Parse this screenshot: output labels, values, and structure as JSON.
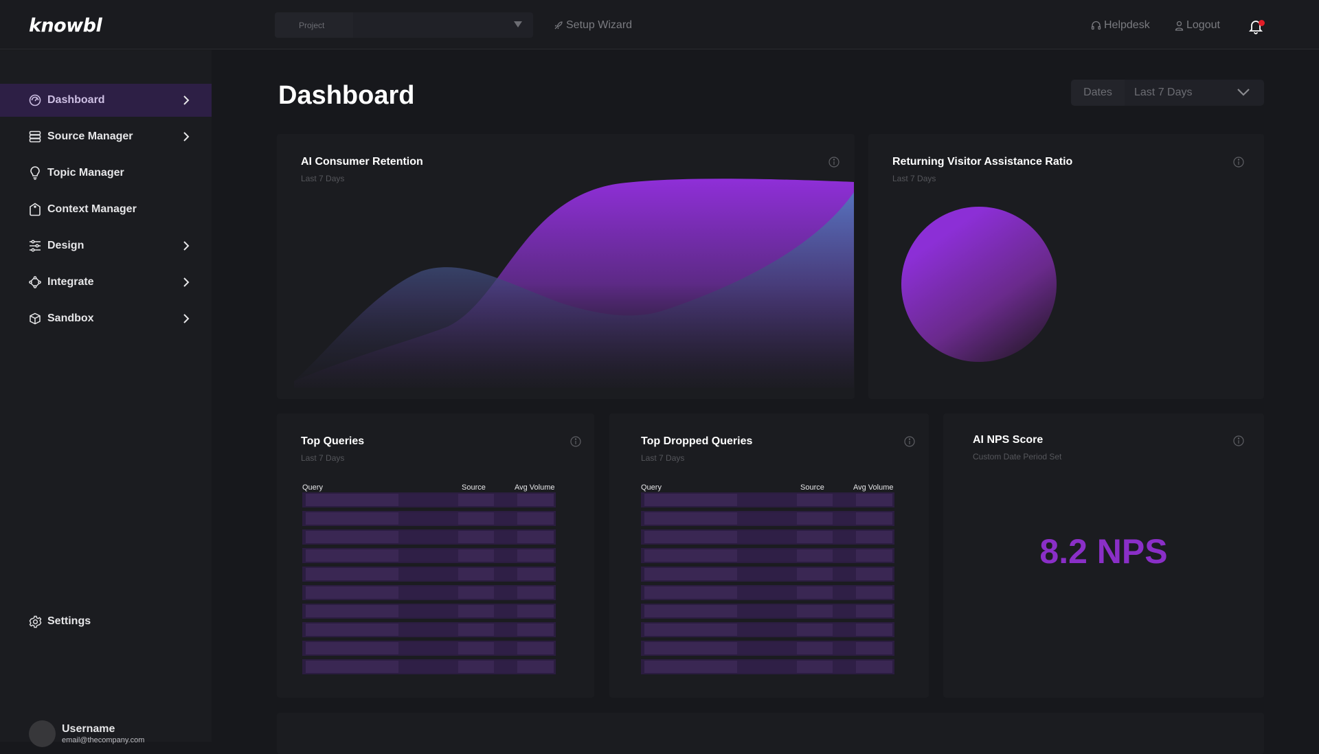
{
  "app": {
    "logo": "knowbl"
  },
  "topbar": {
    "project_placeholder": "Project",
    "setup_wizard": "Setup Wizard",
    "helpdesk": "Helpdesk",
    "logout": "Logout",
    "notification_dot_color": "#e11d27"
  },
  "sidebar": {
    "items": [
      {
        "label": "Dashboard",
        "icon": "speedometer-icon",
        "has_chevron": true,
        "active": true
      },
      {
        "label": "Source Manager",
        "icon": "database-icon",
        "has_chevron": true,
        "active": false
      },
      {
        "label": "Topic Manager",
        "icon": "lightbulb-icon",
        "has_chevron": false,
        "active": false
      },
      {
        "label": "Context Manager",
        "icon": "tag-icon",
        "has_chevron": false,
        "active": false
      },
      {
        "label": "Design",
        "icon": "sliders-icon",
        "has_chevron": true,
        "active": false
      },
      {
        "label": "Integrate",
        "icon": "integrate-icon",
        "has_chevron": true,
        "active": false
      },
      {
        "label": "Sandbox",
        "icon": "cube-icon",
        "has_chevron": true,
        "active": false
      }
    ],
    "settings": "Settings",
    "user": {
      "name": "Username",
      "email": "email@thecompany.com"
    }
  },
  "main": {
    "title": "Dashboard",
    "dates": {
      "label": "Dates",
      "value": "Last 7 Days"
    },
    "cards": {
      "retention": {
        "title": "AI Consumer Retention",
        "subtitle": "Last 7 Days"
      },
      "ratio": {
        "title": "Returning Visitor Assistance Ratio",
        "subtitle": "Last 7 Days"
      },
      "top_queries": {
        "title": "Top Queries",
        "subtitle": "Last 7 Days",
        "columns": [
          "Query",
          "Source",
          "Avg Volume"
        ],
        "row_count": 10
      },
      "dropped_queries": {
        "title": "Top Dropped Queries",
        "subtitle": "Last 7 Days",
        "columns": [
          "Query",
          "Source",
          "Avg Volume"
        ],
        "row_count": 10
      },
      "nps": {
        "title": "AI NPS Score",
        "subtitle": "Custom Date Period Set",
        "value": "8.2 NPS"
      }
    }
  },
  "colors": {
    "accent": "#8a2fc7",
    "active_nav": "#2d1f45",
    "cyan": "#3bb3dd"
  }
}
